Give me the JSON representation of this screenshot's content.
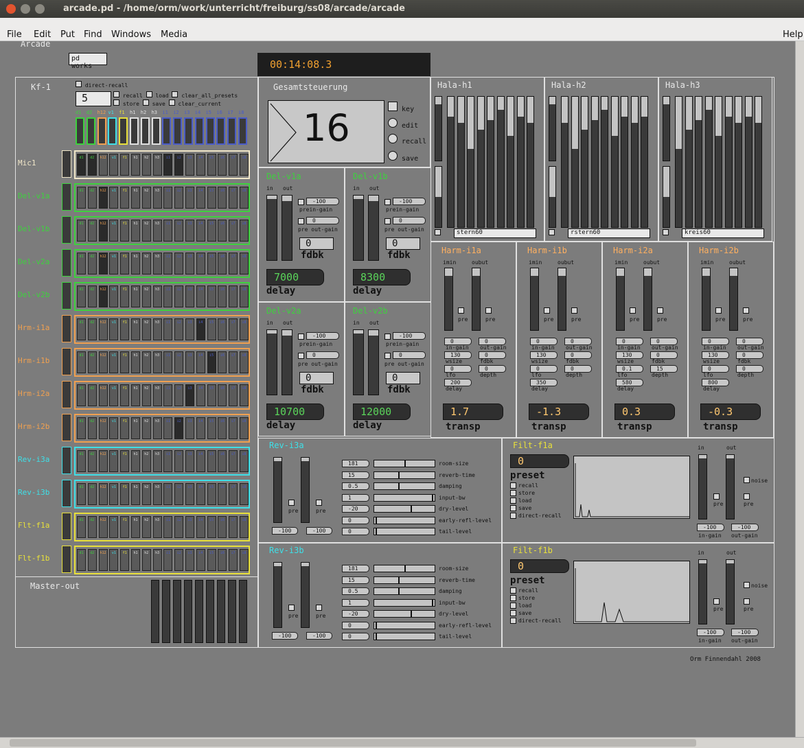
{
  "window": {
    "title": "arcade.pd  - /home/orm/work/unterricht/freiburg/ss08/arcade/arcade"
  },
  "menu": [
    "File",
    "Edit",
    "Put",
    "Find",
    "Windows",
    "Media"
  ],
  "menu_help": "Help",
  "header": {
    "title": "Arcade",
    "pd_works": "pd works",
    "clock": "00:14:08.3"
  },
  "kf": {
    "title": "Kf-1",
    "direct_recall": "direct-recall",
    "preset": "5",
    "recall": "recall",
    "load": "load",
    "clear_all": "clear_all_presets",
    "store": "store",
    "save": "save",
    "clear_current": "clear_current"
  },
  "columns": [
    "d1",
    "d2",
    "h12",
    "v1",
    "f1",
    "h1",
    "h2",
    "h3",
    "i1",
    "i2",
    "i3",
    "i4",
    "i5",
    "i6",
    "i7",
    "i8"
  ],
  "rows": [
    {
      "label": "Mic1",
      "color": "#f0e6c8"
    },
    {
      "label": "Del-v1a",
      "color": "#3ed13e"
    },
    {
      "label": "Del-v1b",
      "color": "#3ed13e"
    },
    {
      "label": "Del-v2a",
      "color": "#3ed13e"
    },
    {
      "label": "Del-v2b",
      "color": "#3ed13e"
    },
    {
      "label": "Hrm-i1a",
      "color": "#f0a050"
    },
    {
      "label": "Hrm-i1b",
      "color": "#f0a050"
    },
    {
      "label": "Hrm-i2a",
      "color": "#f0a050"
    },
    {
      "label": "Hrm-i2b",
      "color": "#f0a050"
    },
    {
      "label": "Rev-i3a",
      "color": "#3ee0e8"
    },
    {
      "label": "Rev-i3b",
      "color": "#3ee0e8"
    },
    {
      "label": "Flt-f1a",
      "color": "#e8e03a"
    },
    {
      "label": "Flt-f1b",
      "color": "#e8e03a"
    }
  ],
  "master": {
    "label": "Master-out"
  },
  "gesamt": {
    "title": "Gesamtsteuerung",
    "number": "16",
    "key": "key",
    "edit": "edit",
    "recall": "recall",
    "save": "save"
  },
  "delays": [
    {
      "title": "Del-v1a",
      "in": "in",
      "out": "out",
      "ingain": "-100",
      "ingain_lbl": "prein-gain",
      "outgain": "0",
      "outgain_lbl": "pre out-gain",
      "fdbk": "0",
      "fdbk_lbl": "fdbk",
      "delay": "7000",
      "delay_lbl": "delay"
    },
    {
      "title": "Del-v1b",
      "in": "in",
      "out": "out",
      "ingain": "-100",
      "ingain_lbl": "prein-gain",
      "outgain": "0",
      "outgain_lbl": "pre out-gain",
      "fdbk": "0",
      "fdbk_lbl": "fdbk",
      "delay": "8300",
      "delay_lbl": "delay"
    },
    {
      "title": "Del-v2a",
      "in": "in",
      "out": "out",
      "ingain": "-100",
      "ingain_lbl": "prein-gain",
      "outgain": "0",
      "outgain_lbl": "pre out-gain",
      "fdbk": "0",
      "fdbk_lbl": "fdbk",
      "delay": "10700",
      "delay_lbl": "delay"
    },
    {
      "title": "Del-v2b",
      "in": "in",
      "out": "out",
      "ingain": "-100",
      "ingain_lbl": "prein-gain",
      "outgain": "0",
      "outgain_lbl": "pre out-gain",
      "fdbk": "0",
      "fdbk_lbl": "fdbk",
      "delay": "12000",
      "delay_lbl": "delay"
    }
  ],
  "hala": [
    {
      "title": "Hala-h1",
      "name": "stern60"
    },
    {
      "title": "Hala-h2",
      "name": "rstern60"
    },
    {
      "title": "Hala-h3",
      "name": "kreis60"
    }
  ],
  "harm": [
    {
      "title": "Harm-i1a",
      "in": "imin",
      "out": "oubut",
      "pre": "pre",
      "ingain": "0",
      "outgain": "0",
      "wsize": "130",
      "fdbk": "0",
      "lfo": "0",
      "depth": "0",
      "delay": "200",
      "transp": "1.7"
    },
    {
      "title": "Harm-i1b",
      "in": "imin",
      "out": "oubut",
      "pre": "pre",
      "ingain": "0",
      "outgain": "0",
      "wsize": "130",
      "fdbk": "0",
      "lfo": "0",
      "depth": "0",
      "delay": "350",
      "transp": "-1.3"
    },
    {
      "title": "Harm-i2a",
      "in": "imin",
      "out": "oubut",
      "pre": "pre",
      "ingain": "0",
      "outgain": "0",
      "wsize": "130",
      "fdbk": "0",
      "lfo": "0.1",
      "depth": "15",
      "delay": "580",
      "transp": "0.3"
    },
    {
      "title": "Harm-i2b",
      "in": "imin",
      "out": "oubut",
      "pre": "pre",
      "ingain": "0",
      "outgain": "0",
      "wsize": "130",
      "fdbk": "0",
      "lfo": "0",
      "depth": "0",
      "delay": "800",
      "transp": "-0.3"
    }
  ],
  "harm_labels": {
    "ingain": "in-gain",
    "outgain": "out-gain",
    "wsize": "wsize",
    "fdbk": "fdbk",
    "lfo": "lfo",
    "depth": "depth",
    "delay": "delay",
    "transp": "transp"
  },
  "reverbs": [
    {
      "title": "Rev-i3a",
      "params": [
        {
          "v": "181",
          "n": "room-size"
        },
        {
          "v": "15",
          "n": "reverb-time"
        },
        {
          "v": "0.5",
          "n": "damping"
        },
        {
          "v": "1",
          "n": "input-bw"
        },
        {
          "v": "-20",
          "n": "dry-level"
        },
        {
          "v": "0",
          "n": "early-refl-level"
        },
        {
          "v": "0",
          "n": "tail-level"
        }
      ],
      "pre": "pre",
      "ingain": "-100",
      "outgain": "-100"
    },
    {
      "title": "Rev-i3b",
      "params": [
        {
          "v": "181",
          "n": "room-size"
        },
        {
          "v": "15",
          "n": "reverb-time"
        },
        {
          "v": "0.5",
          "n": "damping"
        },
        {
          "v": "1",
          "n": "input-bw"
        },
        {
          "v": "-20",
          "n": "dry-level"
        },
        {
          "v": "0",
          "n": "early-refl-level"
        },
        {
          "v": "0",
          "n": "tail-level"
        }
      ],
      "pre": "pre",
      "ingain": "-100",
      "outgain": "-100"
    }
  ],
  "filters": [
    {
      "title": "Filt-f1a",
      "value": "0",
      "preset": "preset",
      "opts": [
        "recall",
        "store",
        "load",
        "save",
        "direct-recall"
      ],
      "in": "in",
      "out": "out",
      "noise": "noise",
      "pre": "pre",
      "ingain": "-100",
      "outgain": "-100",
      "ingain_lbl": "in-gain",
      "outgain_lbl": "out-gain"
    },
    {
      "title": "Filt-f1b",
      "value": "0",
      "preset": "preset",
      "opts": [
        "recall",
        "store",
        "load",
        "save",
        "direct-recall"
      ],
      "in": "in",
      "out": "out",
      "noise": "noise",
      "pre": "pre",
      "ingain": "-100",
      "outgain": "-100",
      "ingain_lbl": "in-gain",
      "outgain_lbl": "out-gain"
    }
  ],
  "credit": "Orm Finnendahl 2008"
}
